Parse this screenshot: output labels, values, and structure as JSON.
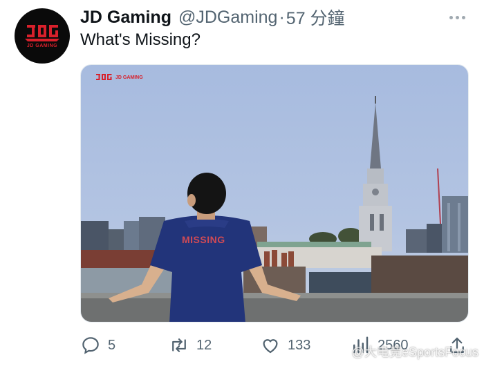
{
  "tweet": {
    "display_name": "JD Gaming",
    "handle": "@JDGaming",
    "separator": "·",
    "time": "57 分鐘",
    "text": "What's Missing?",
    "avatar": {
      "logo": "JDG",
      "name": "JD GAMING",
      "bg_color": "#0a0a0a",
      "accent": "#d8202b"
    },
    "more_icon": "more-horizontal-icon"
  },
  "media": {
    "overlay_logo": "JDG",
    "overlay_brand": "JD GAMING",
    "jersey_text": "MISSING"
  },
  "actions": {
    "replies": "5",
    "retweets": "12",
    "likes": "133",
    "views": "2560"
  },
  "watermark": "@大电竞eSportsFocus"
}
